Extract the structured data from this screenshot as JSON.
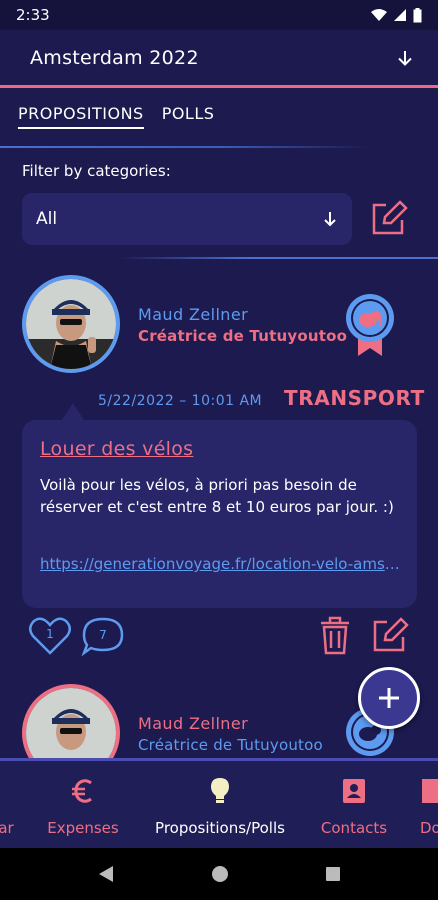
{
  "status_bar": {
    "time": "2:33"
  },
  "header": {
    "trip_title": "Amsterdam 2022"
  },
  "tabs": [
    {
      "label": "PROPOSITIONS",
      "active": true
    },
    {
      "label": "POLLS",
      "active": false
    }
  ],
  "filter": {
    "label": "Filter by categories:",
    "value": "All"
  },
  "posts": [
    {
      "author_name": "Maud Zellner",
      "author_role": "Créatrice de Tutuyoutoo",
      "date": "5/22/2022 – 10:01 AM",
      "category": "TRANSPORT",
      "title": "Louer des vélos",
      "body": "Voilà pour les vélos, à priori pas besoin de réserver et c'est entre 8 et 10 euros par jour. :)",
      "link": "https://generationvoyage.fr/location-velo-amsterdam",
      "likes": "1",
      "comments": "7"
    },
    {
      "author_name": "Maud Zellner",
      "author_role": "Créatrice de Tutuyoutoo"
    }
  ],
  "bottom_nav": [
    {
      "label": "Calendar",
      "icon": "calendar-icon"
    },
    {
      "label": "Expenses",
      "icon": "euro-icon"
    },
    {
      "label": "Propositions/Polls",
      "icon": "lightbulb-icon",
      "active": true
    },
    {
      "label": "Contacts",
      "icon": "contacts-icon"
    },
    {
      "label": "Documents",
      "icon": "document-icon"
    }
  ],
  "colors": {
    "background": "#1c1a4f",
    "accent_pink": "#ee6f84",
    "accent_blue": "#5d9bf0",
    "card": "#282668"
  }
}
